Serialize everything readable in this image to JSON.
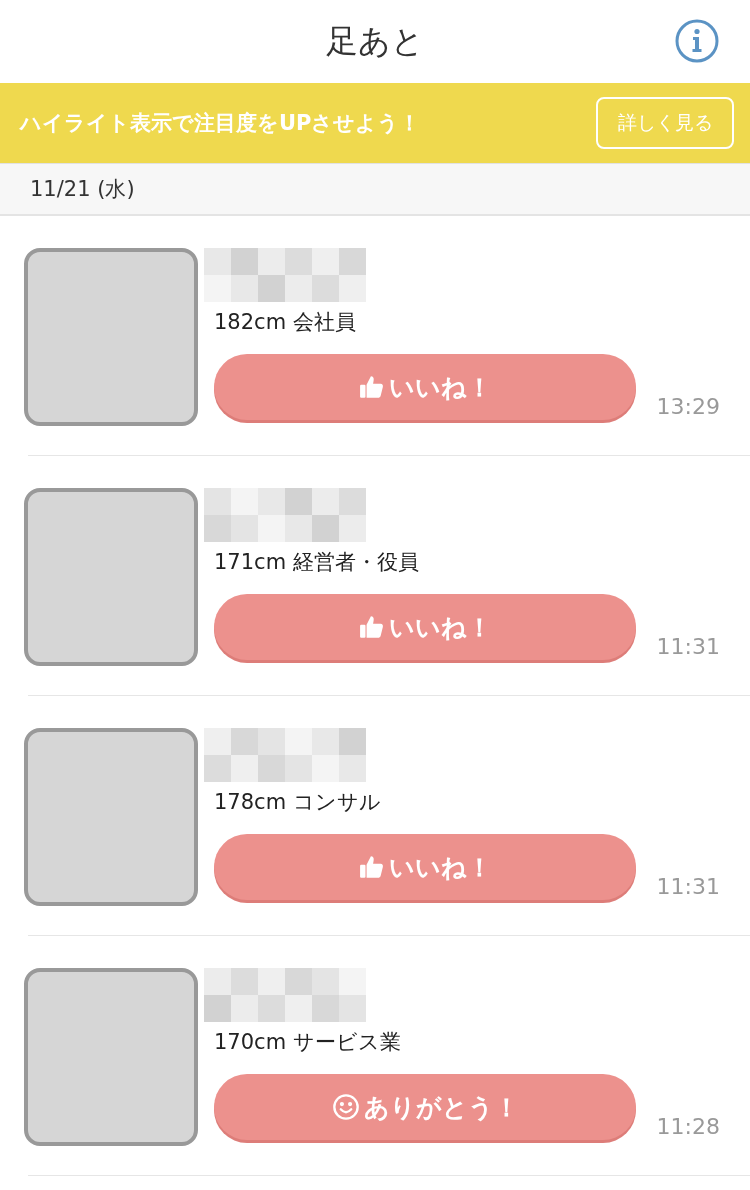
{
  "header": {
    "title": "足あと"
  },
  "banner": {
    "text": "ハイライト表示で注目度をUPさせよう！",
    "button": "詳しく見る"
  },
  "date_header": "11/21 (水)",
  "visitors": [
    {
      "profile": "182cm 会社員",
      "action": {
        "kind": "like",
        "label": "いいね！"
      },
      "time": "13:29"
    },
    {
      "profile": "171cm 経営者・役員",
      "action": {
        "kind": "like",
        "label": "いいね！"
      },
      "time": "11:31"
    },
    {
      "profile": "178cm コンサル",
      "action": {
        "kind": "like",
        "label": "いいね！"
      },
      "time": "11:31"
    },
    {
      "profile": "170cm サービス業",
      "action": {
        "kind": "thanks",
        "label": "ありがとう！"
      },
      "time": "11:28"
    }
  ]
}
